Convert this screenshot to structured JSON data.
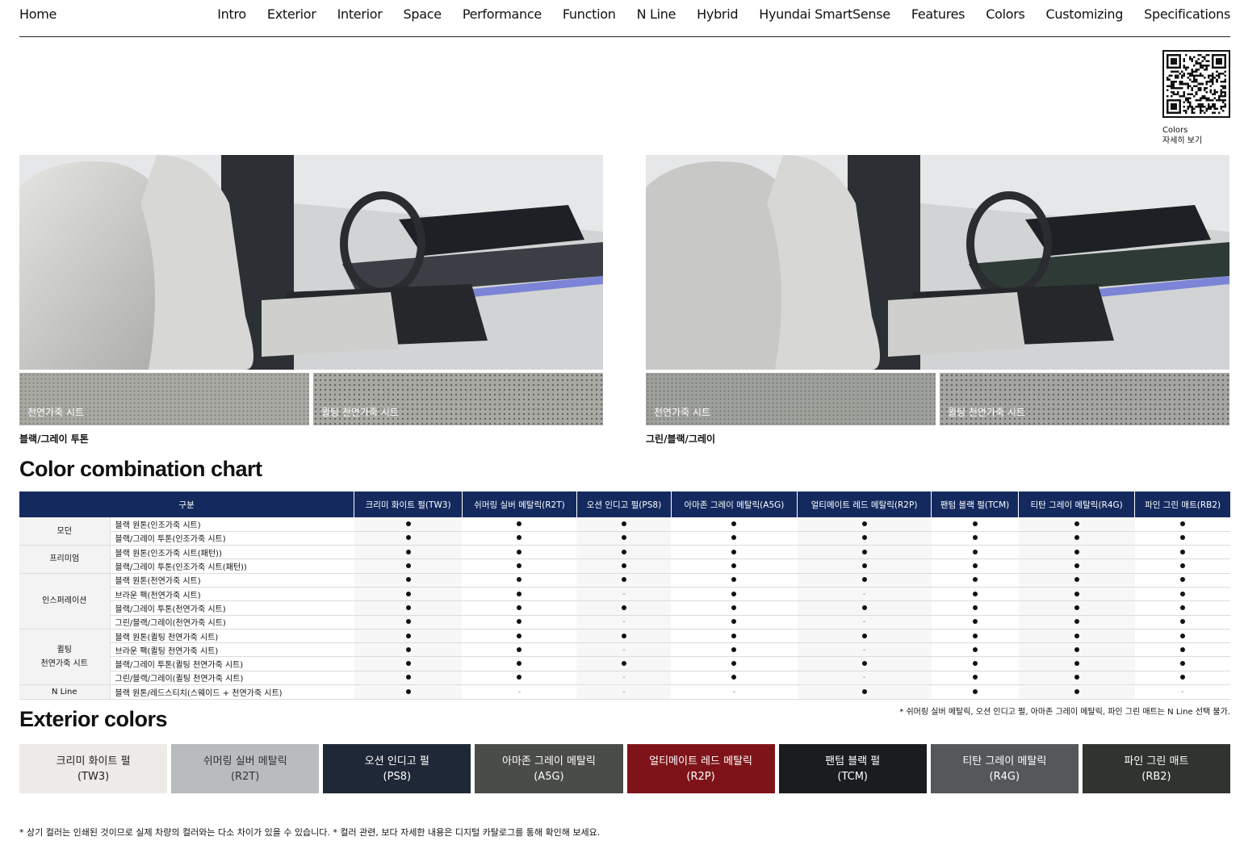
{
  "nav": {
    "home": "Home",
    "items": [
      "Intro",
      "Exterior",
      "Interior",
      "Space",
      "Performance",
      "Function",
      "N Line",
      "Hybrid",
      "Hyundai SmartSense",
      "Features",
      "Colors",
      "Customizing",
      "Specifications"
    ]
  },
  "qr": {
    "line1": "Colors",
    "line2": "자세히 보기"
  },
  "interiors": [
    {
      "caption": "블랙/그레이 투톤",
      "swatch1": "천연가죽 시트",
      "swatch2": "퀼팅 천연가죽 시트"
    },
    {
      "caption": "그린/블랙/그레이",
      "swatch1": "천연가죽 시트",
      "swatch2": "퀼팅 천연가죽 시트"
    }
  ],
  "chart_title": "Color combination chart",
  "table": {
    "corner": "구분",
    "columns": [
      "크리미 화이트 펄(TW3)",
      "쉬머링 실버 메탈릭(R2T)",
      "오션 인디고 펄(PS8)",
      "아마존 그레이 메탈릭(A5G)",
      "얼티메이트 레드 메탈릭(R2P)",
      "팬텀 블랙 펄(TCM)",
      "티탄 그레이 메탈릭(R4G)",
      "파인 그린 매트(RB2)"
    ],
    "groups": [
      {
        "name": "모던",
        "rows": [
          {
            "label": "블랙 원톤(인조가죽 시트)",
            "values": [
              1,
              1,
              1,
              1,
              1,
              1,
              1,
              1
            ]
          },
          {
            "label": "블랙/그레이 투톤(인조가죽 시트)",
            "values": [
              1,
              1,
              1,
              1,
              1,
              1,
              1,
              1
            ]
          }
        ]
      },
      {
        "name": "프리미엄",
        "rows": [
          {
            "label": "블랙 원톤(인조가죽 시트(패턴))",
            "values": [
              1,
              1,
              1,
              1,
              1,
              1,
              1,
              1
            ]
          },
          {
            "label": "블랙/그레이 투톤(인조가죽 시트(패턴))",
            "values": [
              1,
              1,
              1,
              1,
              1,
              1,
              1,
              1
            ]
          }
        ]
      },
      {
        "name": "인스퍼레이션",
        "rows": [
          {
            "label": "블랙 원톤(천연가죽 시트)",
            "values": [
              1,
              1,
              1,
              1,
              1,
              1,
              1,
              1
            ]
          },
          {
            "label": "브라운 팩(천연가죽 시트)",
            "values": [
              1,
              1,
              0,
              1,
              0,
              1,
              1,
              1
            ]
          },
          {
            "label": "블랙/그레이 투톤(천연가죽 시트)",
            "values": [
              1,
              1,
              1,
              1,
              1,
              1,
              1,
              1
            ]
          },
          {
            "label": "그린/블랙/그레이(천연가죽 시트)",
            "values": [
              1,
              1,
              0,
              1,
              0,
              1,
              1,
              1
            ]
          }
        ]
      },
      {
        "name": "퀼팅\n천연가죽 시트",
        "rows": [
          {
            "label": "블랙 원톤(퀼팅 천연가죽 시트)",
            "values": [
              1,
              1,
              1,
              1,
              1,
              1,
              1,
              1
            ]
          },
          {
            "label": "브라운 팩(퀼팅 천연가죽 시트)",
            "values": [
              1,
              1,
              0,
              1,
              0,
              1,
              1,
              1
            ]
          },
          {
            "label": "블랙/그레이 투톤(퀼팅 천연가죽 시트)",
            "values": [
              1,
              1,
              1,
              1,
              1,
              1,
              1,
              1
            ]
          },
          {
            "label": "그린/블랙/그레이(퀼팅 천연가죽 시트)",
            "values": [
              1,
              1,
              0,
              1,
              0,
              1,
              1,
              1
            ]
          }
        ]
      },
      {
        "name": "N Line",
        "rows": [
          {
            "label": "블랙 원톤/레드스티치(스웨이드 + 천연가죽 시트)",
            "values": [
              1,
              0,
              0,
              0,
              1,
              1,
              1,
              0
            ]
          }
        ]
      }
    ],
    "note": "* 쉬머링 실버 메탈릭, 오션 인디고 펄, 아마존 그레이 메탈릭, 파인 그린 매트는 N Line 선택 불가."
  },
  "exterior_title": "Exterior colors",
  "exterior": [
    {
      "name": "크리미 화이트 펄",
      "code": "(TW3)",
      "bg": "#ecebe7",
      "fg": "#222222"
    },
    {
      "name": "쉬머링 실버 메탈릭",
      "code": "(R2T)",
      "bg": "#b9bbbd",
      "fg": "#333333"
    },
    {
      "name": "오션 인디고 펄",
      "code": "(PS8)",
      "bg": "#1f2836",
      "fg": "#ffffff"
    },
    {
      "name": "아마존 그레이 메탈릭",
      "code": "(A5G)",
      "bg": "#4a4c47",
      "fg": "#ffffff"
    },
    {
      "name": "얼티메이트 레드 메탈릭",
      "code": "(R2P)",
      "bg": "#7e1419",
      "fg": "#ffffff"
    },
    {
      "name": "팬텀 블랙 펄",
      "code": "(TCM)",
      "bg": "#1b1c1e",
      "fg": "#ffffff"
    },
    {
      "name": "티탄 그레이 메탈릭",
      "code": "(R4G)",
      "bg": "#55585b",
      "fg": "#ffffff"
    },
    {
      "name": "파인 그린 매트",
      "code": "(RB2)",
      "bg": "#2f3430",
      "fg": "#ffffff"
    }
  ],
  "footnote": "* 상기 컬러는 인쇄된 것이므로 실제 차량의 컬러와는 다소 차이가 있을 수 있습니다.  * 컬러 관련, 보다 자세한 내용은 디지털 카탈로그를 통해 확인해 보세요."
}
